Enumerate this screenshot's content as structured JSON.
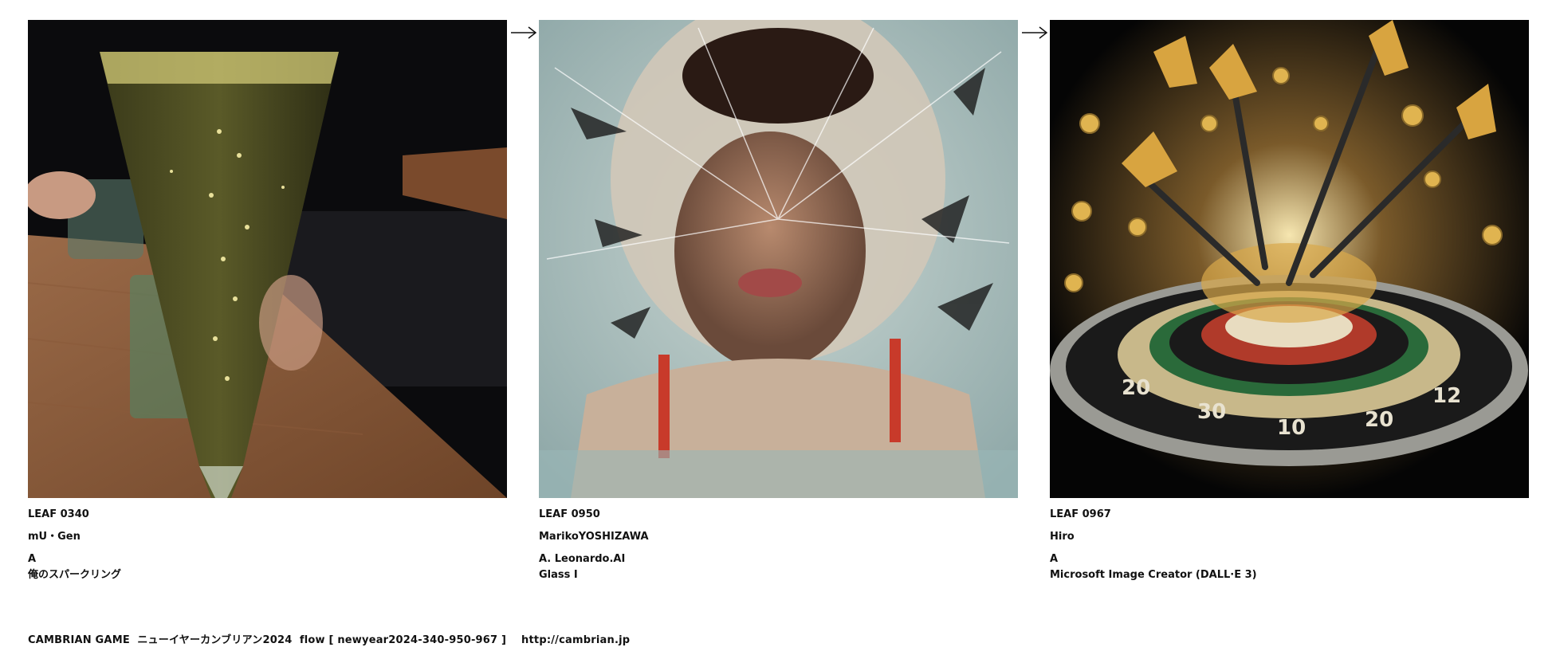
{
  "entries": [
    {
      "leaf": "LEAF 0340",
      "author": "mU・Gen",
      "line1": "A",
      "line2": "俺のスパークリング",
      "image": "champagne-glass-photo"
    },
    {
      "leaf": "LEAF 0950",
      "author": "MarikoYOSHIZAWA",
      "line1": "A. Leonardo.AI",
      "line2": "Glass Ⅰ",
      "image": "shattered-glass-portrait"
    },
    {
      "leaf": "LEAF 0967",
      "author": "Hiro",
      "line1": "A",
      "line2": "Microsoft Image Creator (DALL·E 3)",
      "image": "darts-dartboard-gold-coins"
    }
  ],
  "arrows": [
    "right-arrow-icon",
    "right-arrow-icon"
  ],
  "footer": {
    "text": "CAMBRIAN GAME  ニューイヤーカンブリアン2024  flow [ newyear2024-340-950-967 ]    ",
    "link": "http://cambrian.jp"
  },
  "colors": {
    "background": "#ffffff",
    "text": "#111111",
    "table_wood": "#8a5a3a",
    "glass_bg": "#b7cccc",
    "darts_gold": "#c89a3a"
  }
}
